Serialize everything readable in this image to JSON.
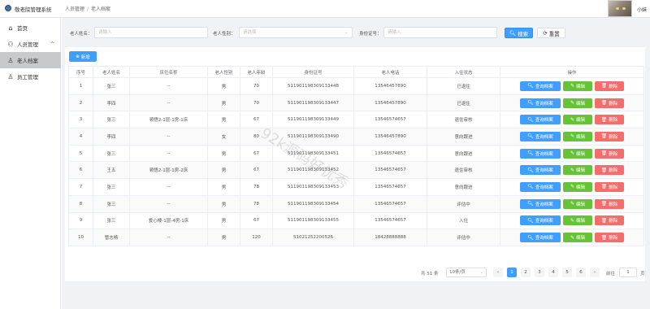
{
  "header": {
    "app_title": "敬老院管理系统",
    "breadcrumb": [
      "人员管理",
      "老人档案"
    ],
    "user_name": "小妹"
  },
  "sidebar": {
    "items": [
      {
        "label": "首页",
        "icon": "home-icon"
      },
      {
        "label": "人员管理",
        "icon": "users-icon",
        "expanded": true
      },
      {
        "label": "老人档案",
        "icon": "user-icon",
        "active": true
      },
      {
        "label": "员工管理",
        "icon": "user-icon"
      }
    ]
  },
  "filters": {
    "name_label": "老人姓名：",
    "name_placeholder": "请输入",
    "gender_label": "老人性别：",
    "gender_placeholder": "请选择",
    "id_label": "身份证号：",
    "id_placeholder": "请输入",
    "search_label": "搜索",
    "reset_label": "重置"
  },
  "toolbar": {
    "add_label": "新增"
  },
  "table": {
    "columns": [
      "序号",
      "老人姓名",
      "床位名称",
      "老人性别",
      "老人年龄",
      "身份证号",
      "老人电话",
      "入住状态",
      "操作"
    ],
    "actions": {
      "query": "查询档案",
      "edit": "编辑",
      "delete": "删除"
    },
    "rows": [
      {
        "no": "1",
        "name": "张三",
        "bed": "--",
        "gender": "男",
        "age": "70",
        "id": "511901198309133448",
        "phone": "13546457890",
        "status": "已退住"
      },
      {
        "no": "2",
        "name": "李四",
        "bed": "--",
        "gender": "男",
        "age": "70",
        "id": "511901198309133447",
        "phone": "13546457890",
        "status": "已退住"
      },
      {
        "no": "3",
        "name": "张三",
        "bed": "顿悟2-1层-1房-1床",
        "gender": "男",
        "age": "67",
        "id": "511901198309133449",
        "phone": "13546574657",
        "status": "退住审核"
      },
      {
        "no": "4",
        "name": "李四",
        "bed": "--",
        "gender": "女",
        "age": "80",
        "id": "511901198309133490",
        "phone": "13546457890",
        "status": "意向跟进"
      },
      {
        "no": "5",
        "name": "张三",
        "bed": "--",
        "gender": "男",
        "age": "67",
        "id": "511901198309133451",
        "phone": "13546574657",
        "status": "意向跟进"
      },
      {
        "no": "6",
        "name": "王五",
        "bed": "顿悟2-1层-1房-2床",
        "gender": "男",
        "age": "67",
        "id": "511901198309133452",
        "phone": "13546574657",
        "status": "退住审核"
      },
      {
        "no": "7",
        "name": "张三",
        "bed": "--",
        "gender": "男",
        "age": "78",
        "id": "511901198309133453",
        "phone": "13546574657",
        "status": "意向跟进"
      },
      {
        "no": "8",
        "name": "张三",
        "bed": "--",
        "gender": "男",
        "age": "78",
        "id": "511901198309133454",
        "phone": "13546574657",
        "status": "评估中"
      },
      {
        "no": "9",
        "name": "张三",
        "bed": "爱心楼-1层-4房-1床",
        "gender": "男",
        "age": "67",
        "id": "511901198309133455",
        "phone": "13546574657",
        "status": "入住"
      },
      {
        "no": "10",
        "name": "管志杨",
        "bed": "--",
        "gender": "男",
        "age": "120",
        "id": "51021252200526",
        "phone": "18428888888",
        "status": "评估中"
      }
    ]
  },
  "pagination": {
    "total": "共 51 条",
    "page_size": "10条/页",
    "prev": "‹",
    "next": "›",
    "pages": [
      "1",
      "2",
      "3",
      "4",
      "5",
      "6"
    ],
    "current": "1",
    "goto_label": "前往",
    "goto_value": "1",
    "goto_suffix": "页"
  },
  "watermark": "92k源码好优秀",
  "colors": {
    "primary": "#409eff",
    "success": "#67c23a",
    "danger": "#f56c6c",
    "sidebar_active": "#c8c9cc"
  }
}
